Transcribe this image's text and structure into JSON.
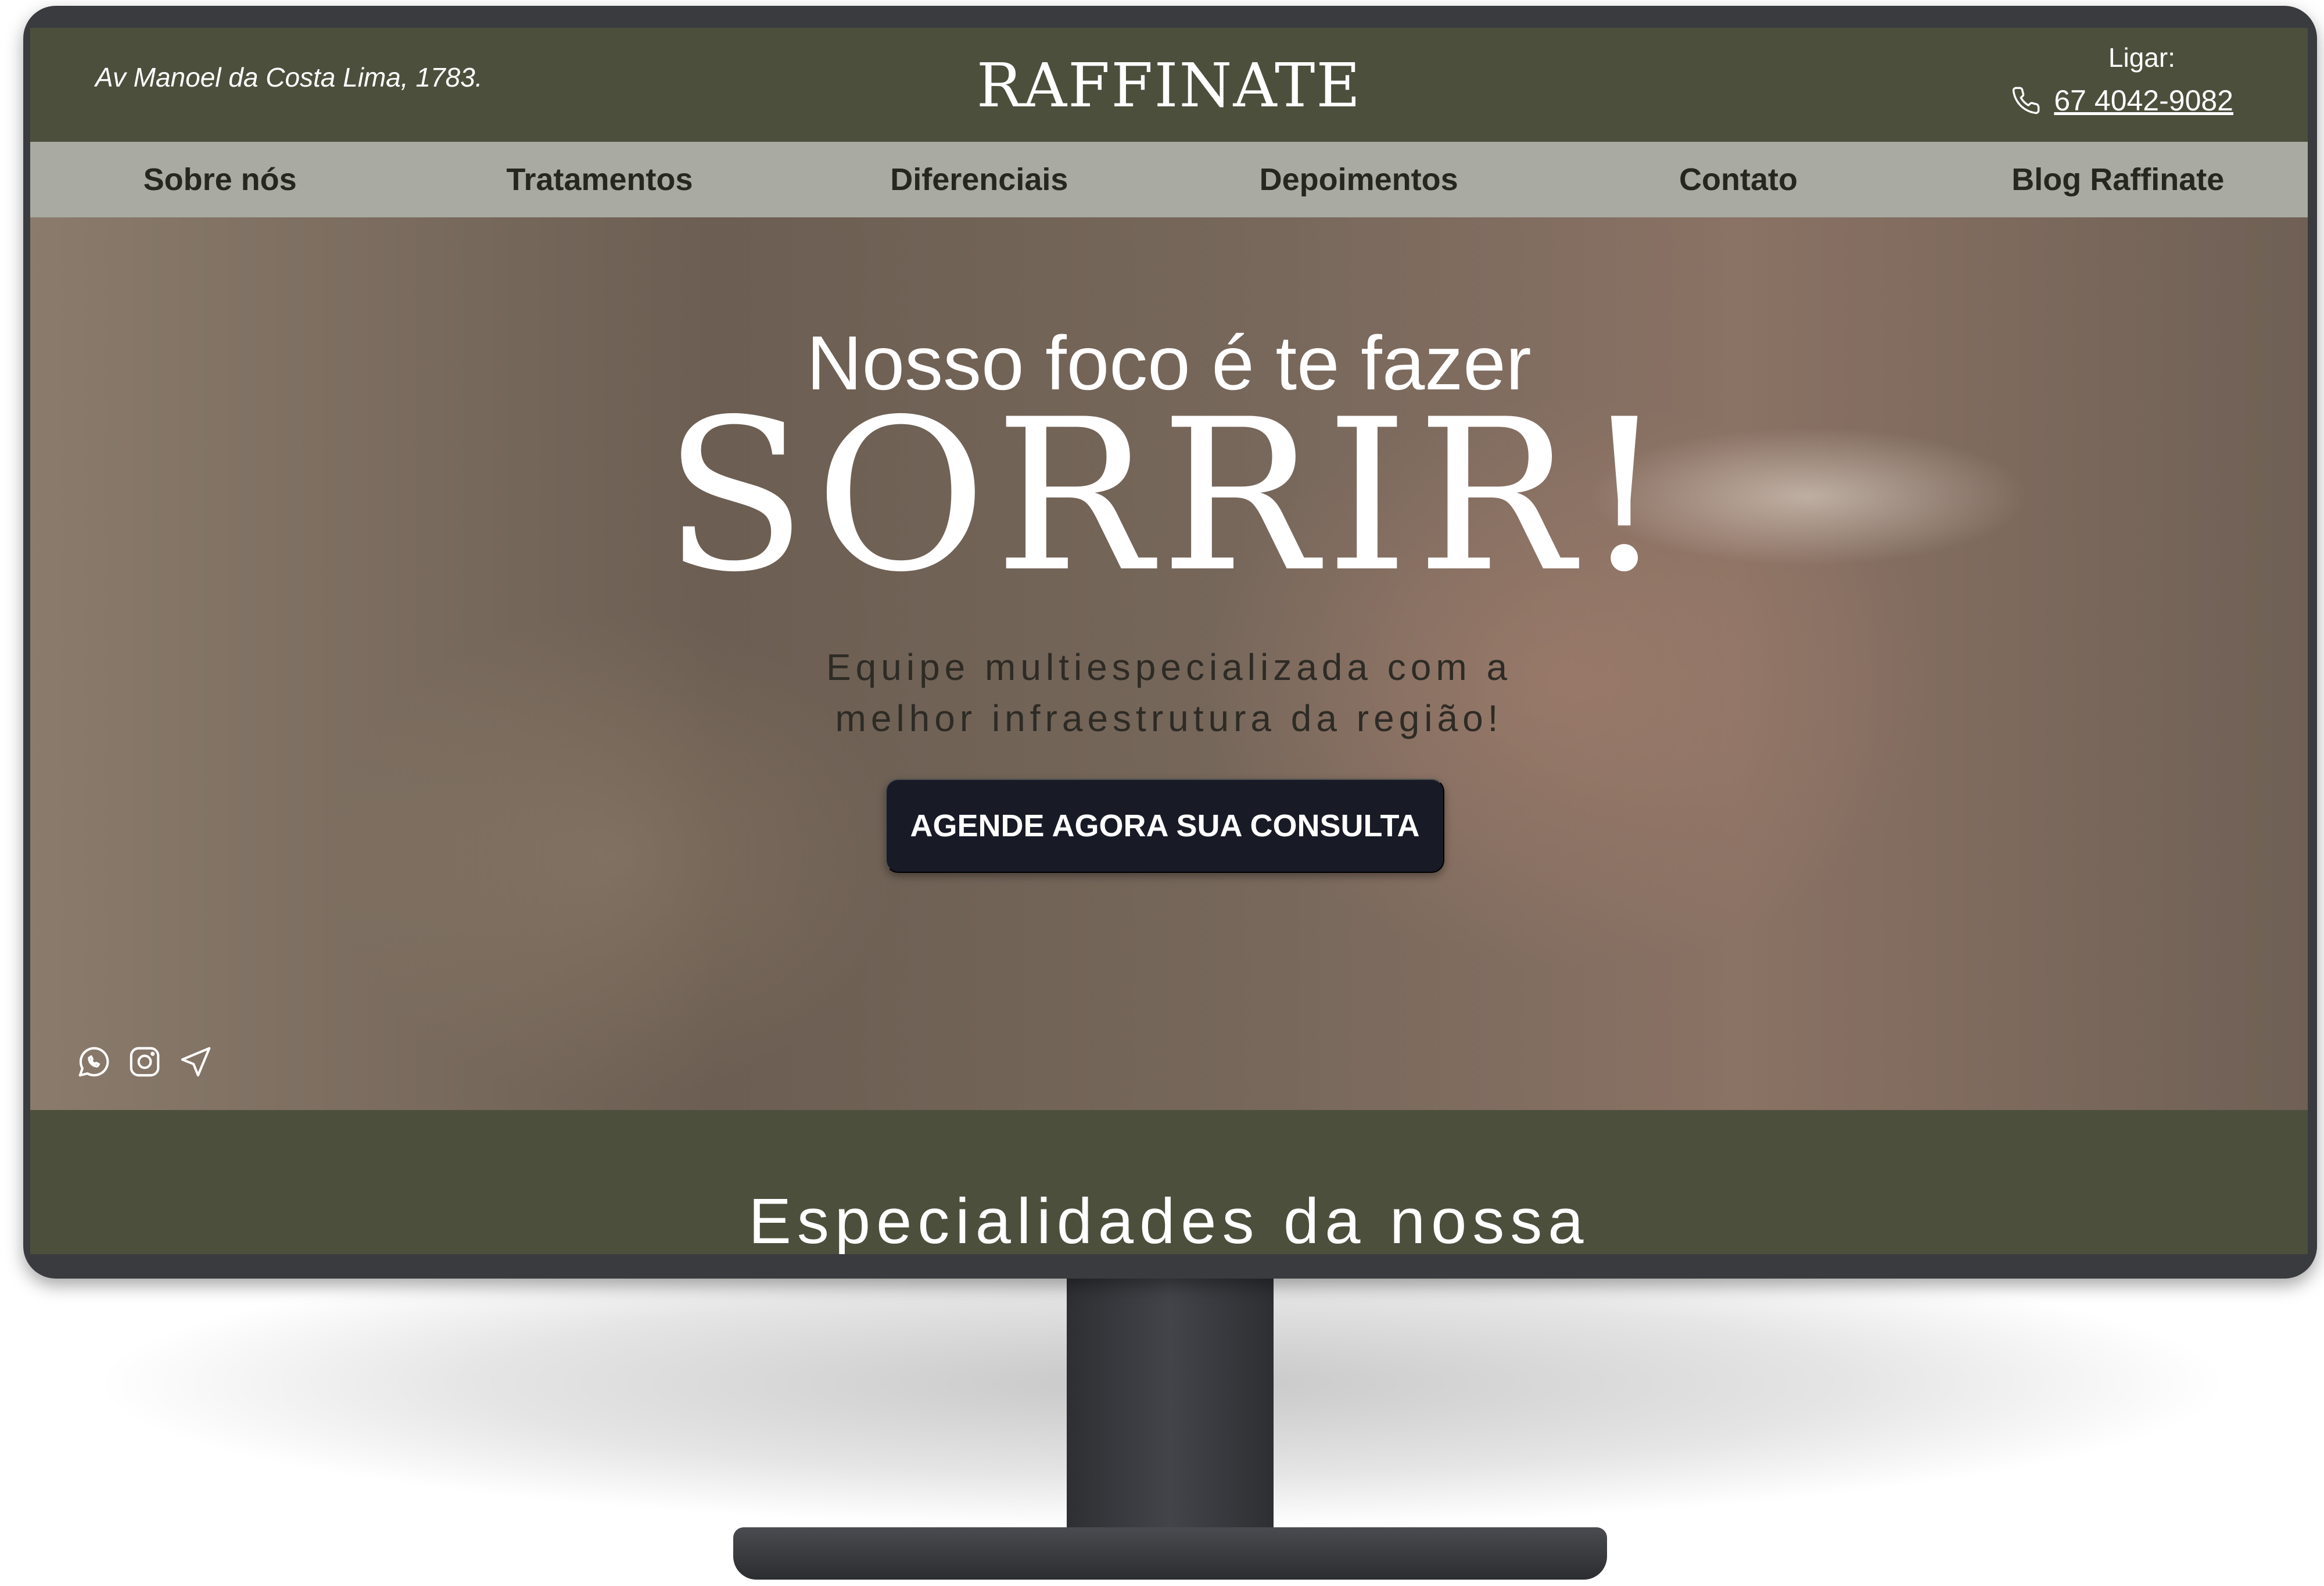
{
  "header": {
    "address": "Av Manoel da Costa Lima, 1783.",
    "logo": "RAFFINATE",
    "call_label": "Ligar:",
    "phone": "67 4042-9082"
  },
  "nav": {
    "items": [
      {
        "label": "Sobre nós"
      },
      {
        "label": "Tratamentos"
      },
      {
        "label": "Diferenciais"
      },
      {
        "label": "Depoimentos"
      },
      {
        "label": "Contato"
      },
      {
        "label": "Blog Raffinate"
      }
    ]
  },
  "hero": {
    "tagline": "Nosso foco é te fazer",
    "headline": "SORRIR!",
    "subtitle": "Equipe multiespecializada com a melhor infraestrutura da região!",
    "cta_label": "AGENDE AGORA SUA CONSULTA"
  },
  "social": {
    "icons": [
      "whatsapp-icon",
      "instagram-icon",
      "location-arrow-icon"
    ]
  },
  "section": {
    "title": "Especialidades da nossa"
  },
  "colors": {
    "header_bg": "#4d4f3d",
    "nav_bg": "#a9aaa1",
    "cta_bg": "#181a26",
    "text_light": "#ffffff"
  }
}
